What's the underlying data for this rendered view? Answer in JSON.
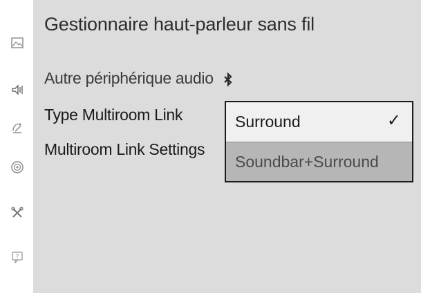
{
  "sidebar": {
    "icons": [
      {
        "name": "picture-icon"
      },
      {
        "name": "speaker-icon"
      },
      {
        "name": "broadcast-icon"
      },
      {
        "name": "network-icon"
      },
      {
        "name": "tools-icon"
      },
      {
        "name": "support-icon"
      }
    ]
  },
  "main": {
    "title": "Gestionnaire haut-parleur sans fil",
    "audio_device_label": "Autre périphérique audio",
    "multiroom_type_label": "Type Multiroom Link",
    "multiroom_settings_label": "Multiroom Link Settings"
  },
  "dropdown": {
    "options": [
      {
        "label": "Surround",
        "selected": true
      },
      {
        "label": "Soundbar+Surround",
        "selected": false
      }
    ],
    "check_glyph": "✓"
  },
  "colors": {
    "panel_bg": "#dcdcdc",
    "dropdown_border": "#1a1a1a",
    "highlight_bg": "#b6b6b6"
  }
}
